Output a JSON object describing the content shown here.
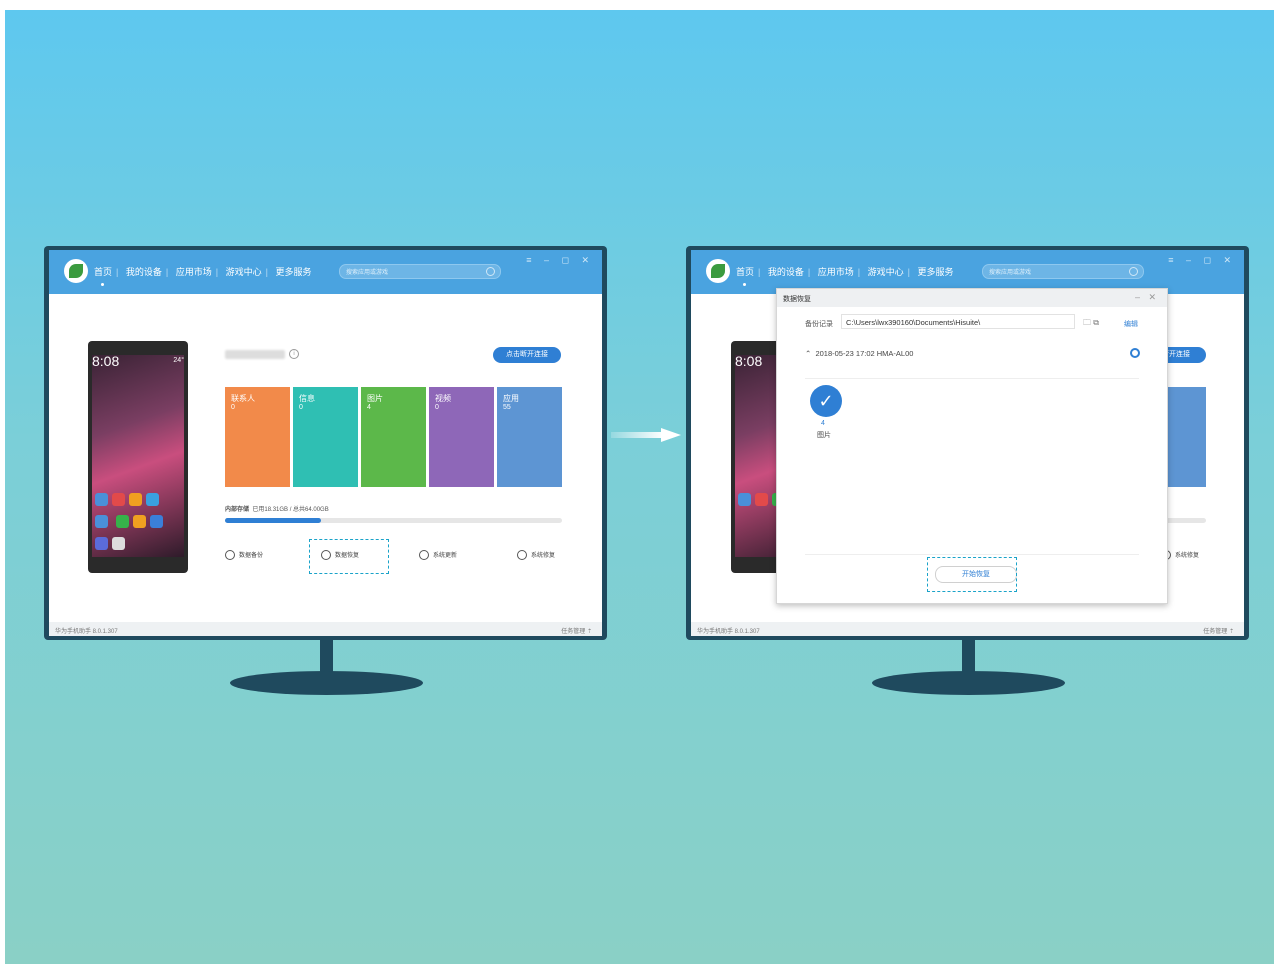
{
  "colors": {
    "accent": "#2f7fd4",
    "header": "#4aa3e0",
    "highlight": "#1aa3c9"
  },
  "nav": {
    "home": "首页",
    "my_device": "我的设备",
    "app_market": "应用市场",
    "game_center": "游戏中心",
    "more_services": "更多服务",
    "search_placeholder": "搜索应用或游戏",
    "search_icon": "search-icon"
  },
  "window_controls": "≡ – ◻ ✕",
  "footer": {
    "version": "华为手机助手 8.0.1.307",
    "task_manager": "任务管理 ⇡"
  },
  "phone": {
    "time": "8:08",
    "weather": "24°"
  },
  "device": {
    "disconnect": "点击断开连接"
  },
  "tiles": [
    {
      "label": "联系人",
      "value": "0",
      "color": "#f28a4a"
    },
    {
      "label": "信息",
      "value": "0",
      "color": "#2fbfb3"
    },
    {
      "label": "图片",
      "value": "4",
      "color": "#5cb84a"
    },
    {
      "label": "视频",
      "value": "0",
      "color": "#8e67b8"
    },
    {
      "label": "应用",
      "value": "55",
      "color": "#5d95d3"
    }
  ],
  "storage": {
    "label": "内部存储",
    "detail": "已用18.31GB / 总共64.00GB",
    "used_fraction": 0.286
  },
  "actions": {
    "backup": "数据备份",
    "restore": "数据恢复",
    "update": "系统更新",
    "repair": "系统修复"
  },
  "dialog": {
    "title": "数据恢复",
    "controls": "– ✕",
    "record_label": "备份记录",
    "path": "C:\\Users\\lwx390160\\Documents\\Hisuite\\",
    "edit": "编辑",
    "entry": "2018-05-23 17:02 HMA-AL00",
    "item_count": "4",
    "item_name": "图片",
    "start_button": "开始恢复"
  },
  "partial": {
    "disconnect": "断开连接",
    "repair": "系统修复"
  }
}
